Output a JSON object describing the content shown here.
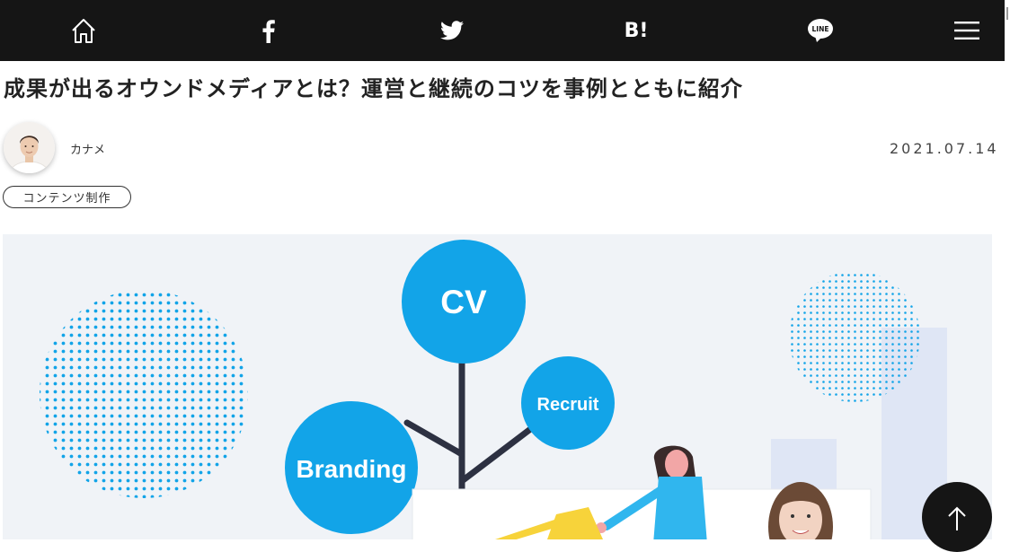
{
  "nav": {
    "hatena_label": "B!",
    "line_label": "LINE"
  },
  "article": {
    "title": "成果が出るオウンドメディアとは？運営と継続のコツを事例とともに紹介",
    "author": "カナメ",
    "date": "2021.07.14",
    "tag": "コンテンツ制作"
  },
  "hero": {
    "bubbles": [
      "CV",
      "Recruit",
      "Branding"
    ],
    "accent": "#12a4e8",
    "background": "#f0f3f7"
  },
  "colors": {
    "topbar": "#151515"
  }
}
